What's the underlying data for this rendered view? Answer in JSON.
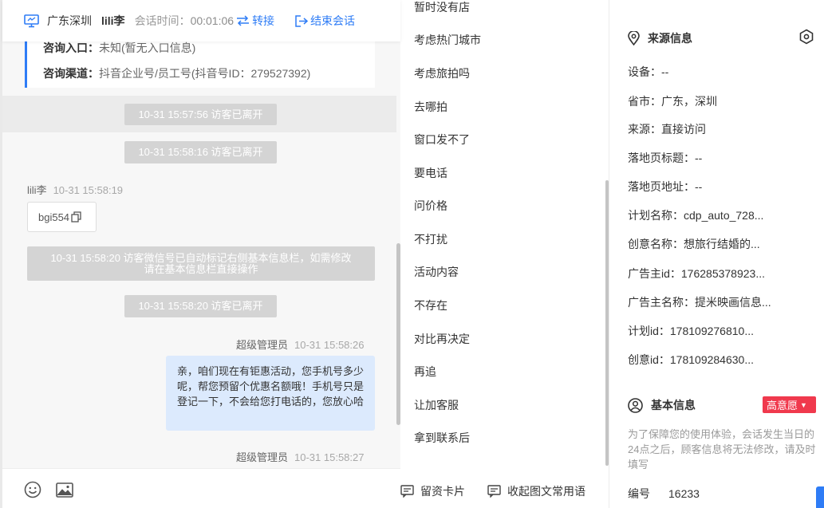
{
  "header": {
    "location": "广东深圳",
    "visitor_name": "lili李",
    "timer_label": "会话时间：",
    "timer_value": "00:01:06",
    "transfer_label": "转接",
    "end_label": "结束会话"
  },
  "info_card": {
    "entry_label": "咨询入口：",
    "entry_value": "未知(暂无入口信息)",
    "channel_label": "咨询渠道：",
    "channel_value": "抖音企业号/员工号(抖音号ID：279527392)"
  },
  "messages": {
    "sys1": "10-31 15:57:56 访客已离开",
    "sys2": "10-31 15:58:16 访客已离开",
    "visitor_sender": "lili李",
    "visitor_time": "10-31 15:58:19",
    "visitor_code": "bgi554",
    "sys_wide_line1": "10-31 15:58:20 访客微信号已自动标记右侧基本信息栏，如需修改",
    "sys_wide_line2": "请在基本信息栏直接操作",
    "sys3": "10-31 15:58:20 访客已离开",
    "agent_sender": "超级管理员",
    "agent_time": "10-31 15:58:26",
    "agent_text": "亲，咱们现在有钜惠活动，您手机号多少呢，帮您预留个优惠名额哦！手机号只是登记一下，不会给您打电话的，您放心哈",
    "agent_sender2": "超级管理员",
    "agent_time2": "10-31 15:58:27"
  },
  "phrases": {
    "items": [
      "暂时没有店",
      "考虑热门城市",
      "考虑旅拍吗",
      "去哪拍",
      "窗口发不了",
      "要电话",
      "问价格",
      "不打扰",
      "活动内容",
      "不存在",
      "对比再决定",
      "再追",
      "让加客服",
      "拿到联系后"
    ],
    "card_label": "留资卡片",
    "collapse_label": "收起图文常用语"
  },
  "source": {
    "title": "来源信息",
    "device": "设备：--",
    "region": "省市：广东，深圳",
    "origin": "来源：直接访问",
    "landing_title": "落地页标题：--",
    "landing_url": "落地页地址：--",
    "plan_name": "计划名称：cdp_auto_728...",
    "creative_name": "创意名称：想旅行结婚的...",
    "advertiser_id": "广告主id：176285378923...",
    "advertiser_name": "广告主名称：提米映画信息...",
    "plan_id": "计划id：178109276810...",
    "creative_id": "创意id：178109284630..."
  },
  "basic": {
    "title": "基本信息",
    "intent": "高意愿",
    "notice": "为了保障您的使用体验，会话发生当日的24点之后，顾客信息将无法修改，请及时填写",
    "number_label": "编号",
    "number_value": "16233"
  },
  "colors": {
    "accent": "#2e7cf6",
    "intent_badge": "#f0394d",
    "agent_bubble": "#dceafd"
  }
}
